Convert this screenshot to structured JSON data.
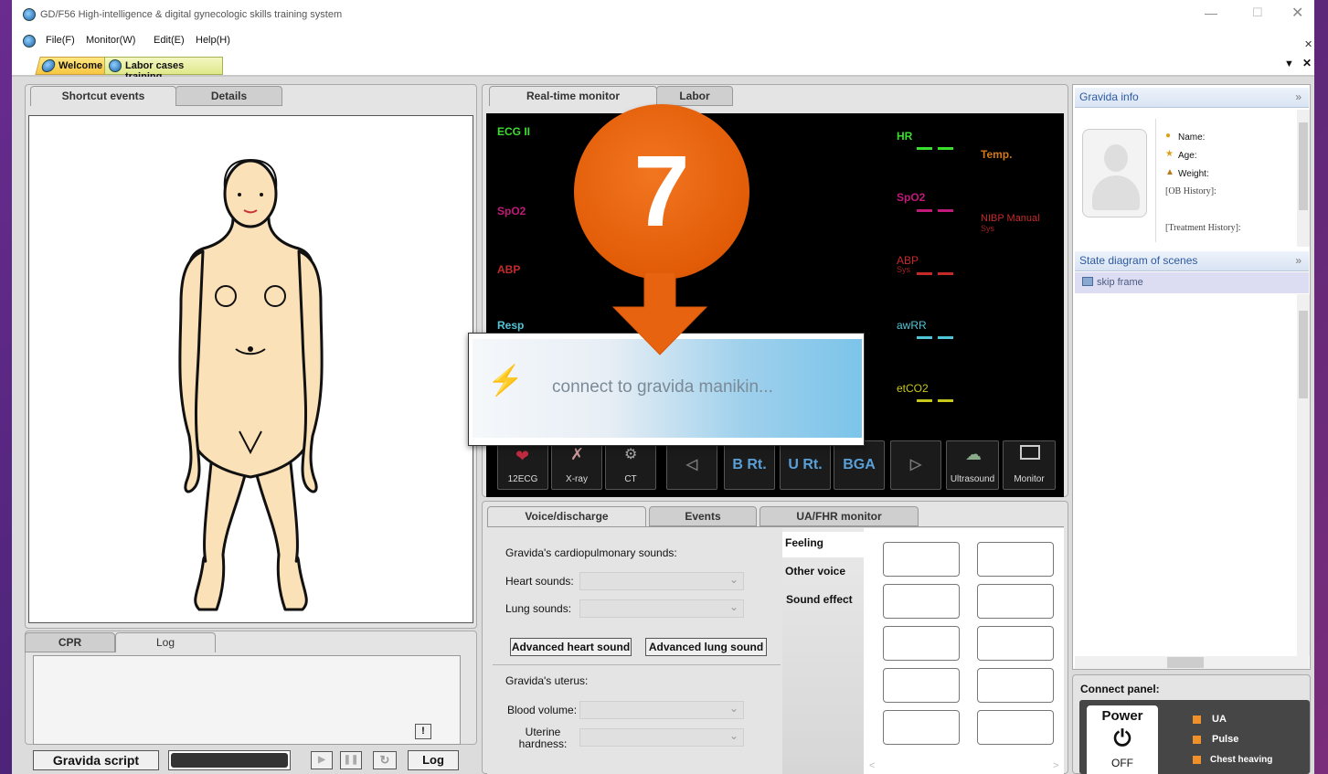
{
  "window": {
    "title": "GD/F56 High-intelligence & digital gynecologic skills training system"
  },
  "menu": [
    "File(F)",
    "Monitor(W)",
    "Edit(E)",
    "Help(H)"
  ],
  "doc_tabs": [
    {
      "label": "Welcome"
    },
    {
      "label": "Labor cases training"
    }
  ],
  "left_panel": {
    "tabs": [
      "Shortcut events",
      "Details"
    ],
    "bottom_tabs": [
      "CPR",
      "Log"
    ],
    "alert_icon": "!",
    "script_button": "Gravida script",
    "log_button": "Log",
    "playback_icons": [
      "play-icon",
      "pause-icon",
      "refresh-icon"
    ]
  },
  "monitor": {
    "tabs": [
      "Real-time monitor",
      "Labor"
    ],
    "left_labels": {
      "ecg": "ECG II",
      "spo2": "SpO2",
      "abp": "ABP",
      "resp": "Resp"
    },
    "right_labels": {
      "hr": "HR",
      "temp": "Temp.",
      "spo2": "SpO2",
      "nibp": "NIBP Manual",
      "nibp_sub": "Sys",
      "abp": "ABP",
      "abp_sub": "Sys",
      "awrr": "awRR",
      "etco2": "etCO2"
    },
    "colors": {
      "ecg": "#3adf2e",
      "spo2": "#c0197a",
      "abp": "#c42a2a",
      "resp": "#4fc6d8",
      "temp": "#d27a1a",
      "etco2": "#c8c81a"
    },
    "toolbar": [
      {
        "icon": "heart-ecg-icon",
        "label": "12ECG"
      },
      {
        "icon": "xray-icon",
        "label": "X-ray"
      },
      {
        "icon": "ct-icon",
        "label": "CT"
      },
      {
        "icon": "arrow-left-icon",
        "label": "◁"
      },
      {
        "label": "B Rt."
      },
      {
        "label": "U Rt."
      },
      {
        "label": "BGA"
      },
      {
        "icon": "arrow-right-icon",
        "label": "▷"
      },
      {
        "icon": "ultrasound-icon",
        "label": "Ultrasound"
      },
      {
        "icon": "monitor-icon",
        "label": "Monitor"
      }
    ]
  },
  "overlay": {
    "step_number": "7",
    "loading_text": "connect to gravida manikin..."
  },
  "voice": {
    "tabs": [
      "Voice/discharge",
      "Events",
      "UA/FHR monitor"
    ],
    "cardio_title": "Gravida's cardiopulmonary sounds:",
    "heart_label": "Heart sounds:",
    "lung_label": "Lung sounds:",
    "adv_heart": "Advanced heart sound",
    "adv_lung": "Advanced lung sound",
    "uterus_title": "Gravida's uterus:",
    "blood_label": "Blood volume:",
    "hardness_label": "Uterine hardness:",
    "side_tabs": [
      "Feeling",
      "Other voice",
      "Sound effect"
    ]
  },
  "gravida_info": {
    "title": "Gravida info",
    "fields": [
      "Name:",
      "Age:",
      "Weight:",
      "[OB History]:",
      "[Treatment History]:"
    ]
  },
  "state_diagram": {
    "title": "State diagram of scenes",
    "item": "skip frame"
  },
  "connect_panel": {
    "title": "Connect panel:",
    "power_label": "Power",
    "power_state": "OFF",
    "indicators": [
      "UA",
      "Pulse",
      "Chest heaving"
    ],
    "indicator_color": "#f0902a"
  }
}
